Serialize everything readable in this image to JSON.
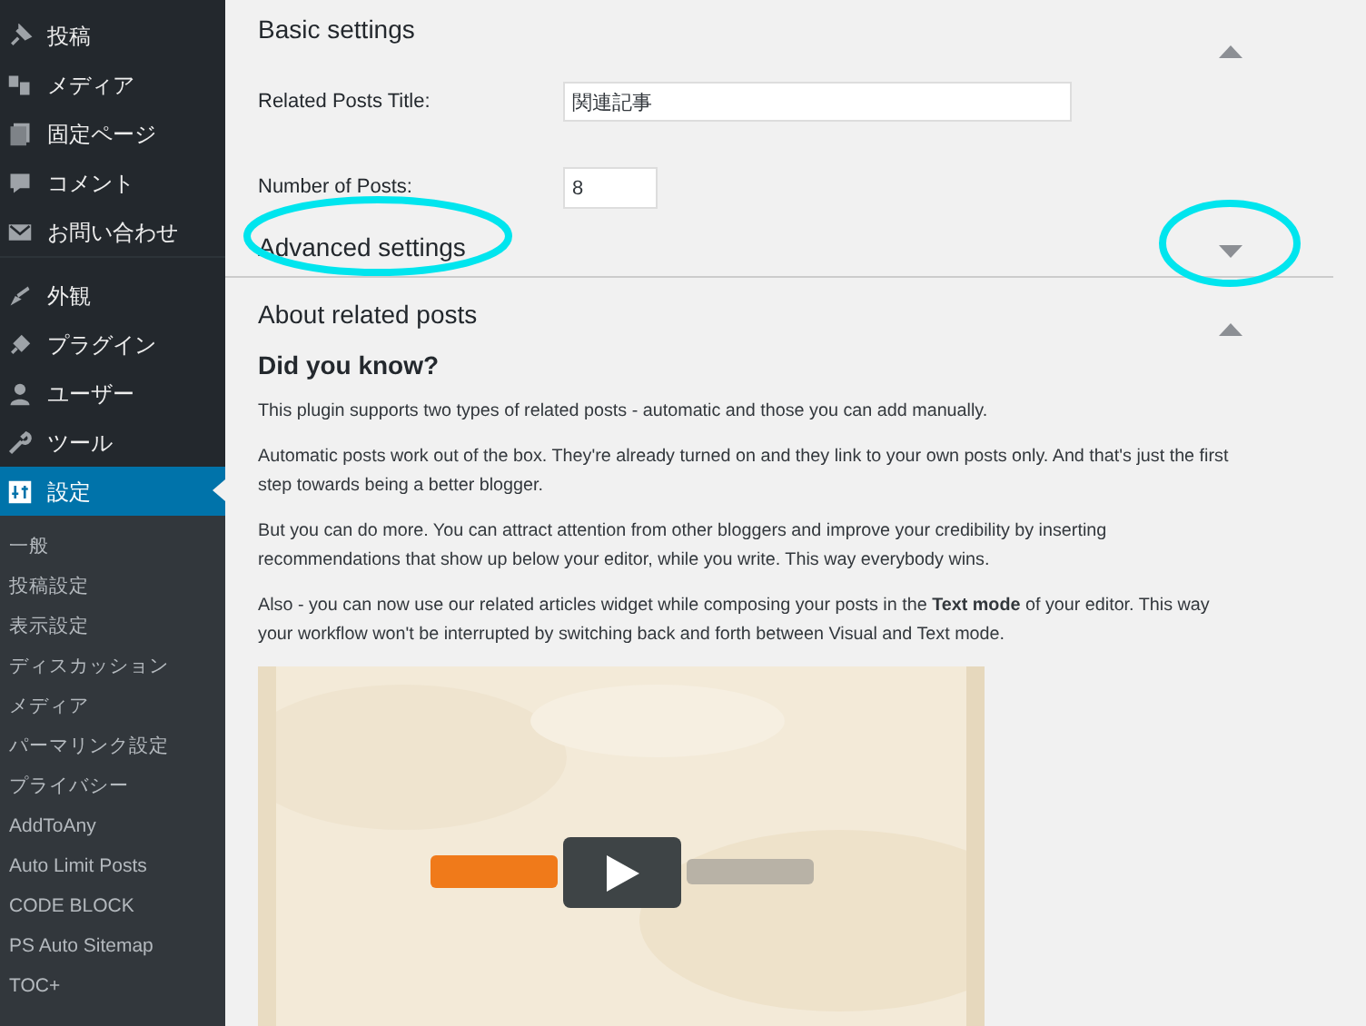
{
  "sidebar": {
    "items": [
      {
        "label": "投稿",
        "selected": false
      },
      {
        "label": "メディア",
        "selected": false
      },
      {
        "label": "固定ページ",
        "selected": false
      },
      {
        "label": "コメント",
        "selected": false
      },
      {
        "label": "お問い合わせ",
        "selected": false
      },
      {
        "label": "外観",
        "selected": false,
        "group_start": true
      },
      {
        "label": "プラグイン",
        "selected": false
      },
      {
        "label": "ユーザー",
        "selected": false
      },
      {
        "label": "ツール",
        "selected": false
      },
      {
        "label": "設定",
        "selected": true
      }
    ],
    "submenu": [
      "一般",
      "投稿設定",
      "表示設定",
      "ディスカッション",
      "メディア",
      "パーマリンク設定",
      "プライバシー",
      "AddToAny",
      "Auto Limit Posts",
      "CODE BLOCK",
      "PS Auto Sitemap",
      "TOC+"
    ]
  },
  "sections": [
    {
      "title": "Basic settings",
      "expanded": true,
      "highlighted": false,
      "fields": [
        {
          "label": "Related Posts Title:",
          "value": "関連記事",
          "kind": "wide"
        },
        {
          "label": "Number of Posts:",
          "value": "8",
          "kind": "narrow"
        }
      ]
    },
    {
      "title": "Advanced settings",
      "expanded": false,
      "highlighted": true
    },
    {
      "title": "About related posts",
      "expanded": true,
      "highlighted": false,
      "heading": "Did you know?",
      "paragraphs": [
        "This plugin supports two types of related posts - automatic and those you can add manually.",
        "Automatic posts work out of the box. They're already turned on and they link to your own posts only. And that's just the first step towards being a better blogger.",
        "But you can do more. You can attract attention from other bloggers and improve your credibility by inserting recommendations that show up below your editor, while you write. This way everybody wins.",
        "Also - you can now use our related articles widget while composing your posts in the **Text mode** of your editor. This way your workflow won't be interrupted by switching back and forth between Visual and Text mode."
      ]
    }
  ]
}
